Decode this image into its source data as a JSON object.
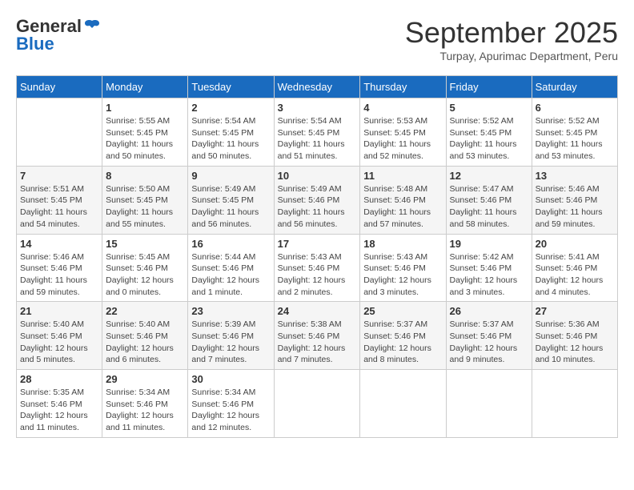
{
  "header": {
    "logo_general": "General",
    "logo_blue": "Blue",
    "month_title": "September 2025",
    "subtitle": "Turpay, Apurimac Department, Peru"
  },
  "days_of_week": [
    "Sunday",
    "Monday",
    "Tuesday",
    "Wednesday",
    "Thursday",
    "Friday",
    "Saturday"
  ],
  "weeks": [
    [
      {
        "day": "",
        "info": ""
      },
      {
        "day": "1",
        "info": "Sunrise: 5:55 AM\nSunset: 5:45 PM\nDaylight: 11 hours\nand 50 minutes."
      },
      {
        "day": "2",
        "info": "Sunrise: 5:54 AM\nSunset: 5:45 PM\nDaylight: 11 hours\nand 50 minutes."
      },
      {
        "day": "3",
        "info": "Sunrise: 5:54 AM\nSunset: 5:45 PM\nDaylight: 11 hours\nand 51 minutes."
      },
      {
        "day": "4",
        "info": "Sunrise: 5:53 AM\nSunset: 5:45 PM\nDaylight: 11 hours\nand 52 minutes."
      },
      {
        "day": "5",
        "info": "Sunrise: 5:52 AM\nSunset: 5:45 PM\nDaylight: 11 hours\nand 53 minutes."
      },
      {
        "day": "6",
        "info": "Sunrise: 5:52 AM\nSunset: 5:45 PM\nDaylight: 11 hours\nand 53 minutes."
      }
    ],
    [
      {
        "day": "7",
        "info": "Sunrise: 5:51 AM\nSunset: 5:45 PM\nDaylight: 11 hours\nand 54 minutes."
      },
      {
        "day": "8",
        "info": "Sunrise: 5:50 AM\nSunset: 5:45 PM\nDaylight: 11 hours\nand 55 minutes."
      },
      {
        "day": "9",
        "info": "Sunrise: 5:49 AM\nSunset: 5:45 PM\nDaylight: 11 hours\nand 56 minutes."
      },
      {
        "day": "10",
        "info": "Sunrise: 5:49 AM\nSunset: 5:46 PM\nDaylight: 11 hours\nand 56 minutes."
      },
      {
        "day": "11",
        "info": "Sunrise: 5:48 AM\nSunset: 5:46 PM\nDaylight: 11 hours\nand 57 minutes."
      },
      {
        "day": "12",
        "info": "Sunrise: 5:47 AM\nSunset: 5:46 PM\nDaylight: 11 hours\nand 58 minutes."
      },
      {
        "day": "13",
        "info": "Sunrise: 5:46 AM\nSunset: 5:46 PM\nDaylight: 11 hours\nand 59 minutes."
      }
    ],
    [
      {
        "day": "14",
        "info": "Sunrise: 5:46 AM\nSunset: 5:46 PM\nDaylight: 11 hours\nand 59 minutes."
      },
      {
        "day": "15",
        "info": "Sunrise: 5:45 AM\nSunset: 5:46 PM\nDaylight: 12 hours\nand 0 minutes."
      },
      {
        "day": "16",
        "info": "Sunrise: 5:44 AM\nSunset: 5:46 PM\nDaylight: 12 hours\nand 1 minute."
      },
      {
        "day": "17",
        "info": "Sunrise: 5:43 AM\nSunset: 5:46 PM\nDaylight: 12 hours\nand 2 minutes."
      },
      {
        "day": "18",
        "info": "Sunrise: 5:43 AM\nSunset: 5:46 PM\nDaylight: 12 hours\nand 3 minutes."
      },
      {
        "day": "19",
        "info": "Sunrise: 5:42 AM\nSunset: 5:46 PM\nDaylight: 12 hours\nand 3 minutes."
      },
      {
        "day": "20",
        "info": "Sunrise: 5:41 AM\nSunset: 5:46 PM\nDaylight: 12 hours\nand 4 minutes."
      }
    ],
    [
      {
        "day": "21",
        "info": "Sunrise: 5:40 AM\nSunset: 5:46 PM\nDaylight: 12 hours\nand 5 minutes."
      },
      {
        "day": "22",
        "info": "Sunrise: 5:40 AM\nSunset: 5:46 PM\nDaylight: 12 hours\nand 6 minutes."
      },
      {
        "day": "23",
        "info": "Sunrise: 5:39 AM\nSunset: 5:46 PM\nDaylight: 12 hours\nand 7 minutes."
      },
      {
        "day": "24",
        "info": "Sunrise: 5:38 AM\nSunset: 5:46 PM\nDaylight: 12 hours\nand 7 minutes."
      },
      {
        "day": "25",
        "info": "Sunrise: 5:37 AM\nSunset: 5:46 PM\nDaylight: 12 hours\nand 8 minutes."
      },
      {
        "day": "26",
        "info": "Sunrise: 5:37 AM\nSunset: 5:46 PM\nDaylight: 12 hours\nand 9 minutes."
      },
      {
        "day": "27",
        "info": "Sunrise: 5:36 AM\nSunset: 5:46 PM\nDaylight: 12 hours\nand 10 minutes."
      }
    ],
    [
      {
        "day": "28",
        "info": "Sunrise: 5:35 AM\nSunset: 5:46 PM\nDaylight: 12 hours\nand 11 minutes."
      },
      {
        "day": "29",
        "info": "Sunrise: 5:34 AM\nSunset: 5:46 PM\nDaylight: 12 hours\nand 11 minutes."
      },
      {
        "day": "30",
        "info": "Sunrise: 5:34 AM\nSunset: 5:46 PM\nDaylight: 12 hours\nand 12 minutes."
      },
      {
        "day": "",
        "info": ""
      },
      {
        "day": "",
        "info": ""
      },
      {
        "day": "",
        "info": ""
      },
      {
        "day": "",
        "info": ""
      }
    ]
  ]
}
